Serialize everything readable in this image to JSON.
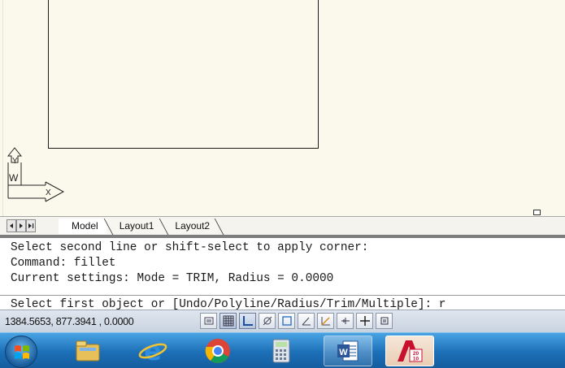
{
  "layout_tabs": {
    "nav_buttons": [
      "first-tab",
      "prev-tab",
      "next-tab",
      "last-tab"
    ],
    "items": [
      {
        "label": "Model",
        "active": true
      },
      {
        "label": "Layout1",
        "active": false
      },
      {
        "label": "Layout2",
        "active": false
      }
    ]
  },
  "ucs_icon": {
    "y_label": "Y",
    "w_label": "W",
    "x_label": "X"
  },
  "command_window": {
    "history": [
      "Select second line or shift-select to apply corner:",
      "Command: fillet",
      "Current settings: Mode = TRIM, Radius = 0.0000"
    ],
    "prompt": "Select first object or [Undo/Polyline/Radius/Trim/Multiple]: r"
  },
  "status_bar": {
    "coordinates": "1384.5653, 877.3941 , 0.0000",
    "toggles": [
      {
        "icon": "infer-constraints-icon",
        "on": false
      },
      {
        "icon": "grid-icon",
        "on": true
      },
      {
        "icon": "ortho-icon",
        "on": true
      },
      {
        "icon": "polar-tracking-icon",
        "on": false
      },
      {
        "icon": "object-snap-icon",
        "on": false
      },
      {
        "icon": "3d-object-snap-icon",
        "on": false
      },
      {
        "icon": "dynamic-ucs-icon",
        "on": false
      },
      {
        "icon": "lineweight-icon",
        "on": false
      },
      {
        "icon": "dynamic-input-icon",
        "on": false
      },
      {
        "icon": "quick-properties-icon",
        "on": false
      }
    ]
  },
  "taskbar": {
    "items": [
      {
        "icon": "windows-start-icon"
      },
      {
        "icon": "file-explorer-icon"
      },
      {
        "icon": "internet-explorer-icon"
      },
      {
        "icon": "chrome-icon"
      },
      {
        "icon": "calculator-icon"
      },
      {
        "icon": "word-icon"
      },
      {
        "icon": "autocad-icon",
        "badge": "20\n10"
      }
    ]
  },
  "colors": {
    "canvas": "#fbf8ec",
    "taskbar": "#1c6fb7",
    "status_bar": "#d3dbe6"
  }
}
